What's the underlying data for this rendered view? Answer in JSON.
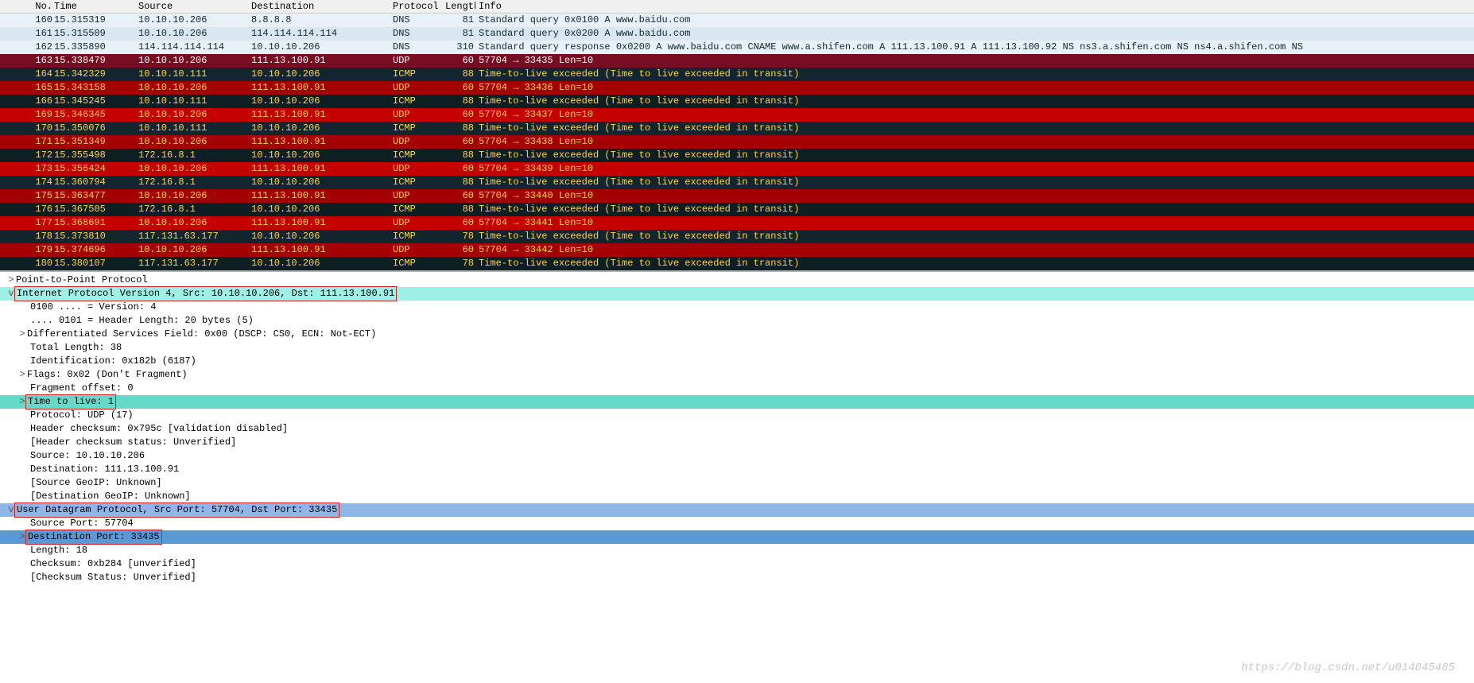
{
  "columns": {
    "no": "No.",
    "time": "Time",
    "src": "Source",
    "dst": "Destination",
    "proto": "Protocol",
    "len": "Length",
    "info": "Info"
  },
  "arrow": "→",
  "packets": [
    {
      "cls": "dns-row",
      "no": 160,
      "time": "15.315319",
      "src": "10.10.10.206",
      "dst": "8.8.8.8",
      "proto": "DNS",
      "len": 81,
      "info": "Standard query 0x0100 A www.baidu.com"
    },
    {
      "cls": "dns-row",
      "no": 161,
      "time": "15.315509",
      "src": "10.10.10.206",
      "dst": "114.114.114.114",
      "proto": "DNS",
      "len": 81,
      "info": "Standard query 0x0200 A www.baidu.com"
    },
    {
      "cls": "dns-row",
      "no": 162,
      "time": "15.335890",
      "src": "114.114.114.114",
      "dst": "10.10.10.206",
      "proto": "DNS",
      "len": 310,
      "info": "Standard query response 0x0200 A www.baidu.com CNAME www.a.shifen.com A 111.13.100.91 A 111.13.100.92 NS ns3.a.shifen.com NS ns4.a.shifen.com NS"
    },
    {
      "cls": "sel-row",
      "no": 163,
      "time": "15.338479",
      "src": "10.10.10.206",
      "dst": "111.13.100.91",
      "proto": "UDP",
      "len": 60,
      "info": "57704 → 33435 Len=10"
    },
    {
      "cls": "blk-row",
      "no": 164,
      "time": "15.342329",
      "src": "10.10.10.111",
      "dst": "10.10.10.206",
      "proto": "ICMP",
      "len": 88,
      "info": "Time-to-live exceeded (Time to live exceeded in transit)"
    },
    {
      "cls": "red-row",
      "no": 165,
      "time": "15.343158",
      "src": "10.10.10.206",
      "dst": "111.13.100.91",
      "proto": "UDP",
      "len": 60,
      "info": "57704 → 33436 Len=10"
    },
    {
      "cls": "blk-row alt",
      "no": 166,
      "time": "15.345245",
      "src": "10.10.10.111",
      "dst": "10.10.10.206",
      "proto": "ICMP",
      "len": 88,
      "info": "Time-to-live exceeded (Time to live exceeded in transit)"
    },
    {
      "cls": "red-row alt",
      "no": 169,
      "time": "15.346345",
      "src": "10.10.10.206",
      "dst": "111.13.100.91",
      "proto": "UDP",
      "len": 60,
      "info": "57704 → 33437 Len=10"
    },
    {
      "cls": "blk-row",
      "no": 170,
      "time": "15.350076",
      "src": "10.10.10.111",
      "dst": "10.10.10.206",
      "proto": "ICMP",
      "len": 88,
      "info": "Time-to-live exceeded (Time to live exceeded in transit)"
    },
    {
      "cls": "red-row",
      "no": 171,
      "time": "15.351349",
      "src": "10.10.10.206",
      "dst": "111.13.100.91",
      "proto": "UDP",
      "len": 60,
      "info": "57704 → 33438 Len=10"
    },
    {
      "cls": "blk-row alt",
      "no": 172,
      "time": "15.355498",
      "src": "172.16.8.1",
      "dst": "10.10.10.206",
      "proto": "ICMP",
      "len": 88,
      "info": "Time-to-live exceeded (Time to live exceeded in transit)"
    },
    {
      "cls": "red-row alt",
      "no": 173,
      "time": "15.356424",
      "src": "10.10.10.206",
      "dst": "111.13.100.91",
      "proto": "UDP",
      "len": 60,
      "info": "57704 → 33439 Len=10"
    },
    {
      "cls": "blk-row",
      "no": 174,
      "time": "15.360794",
      "src": "172.16.8.1",
      "dst": "10.10.10.206",
      "proto": "ICMP",
      "len": 88,
      "info": "Time-to-live exceeded (Time to live exceeded in transit)"
    },
    {
      "cls": "red-row",
      "no": 175,
      "time": "15.363477",
      "src": "10.10.10.206",
      "dst": "111.13.100.91",
      "proto": "UDP",
      "len": 60,
      "info": "57704 → 33440 Len=10"
    },
    {
      "cls": "blk-row alt",
      "no": 176,
      "time": "15.367505",
      "src": "172.16.8.1",
      "dst": "10.10.10.206",
      "proto": "ICMP",
      "len": 88,
      "info": "Time-to-live exceeded (Time to live exceeded in transit)"
    },
    {
      "cls": "red-row alt",
      "no": 177,
      "time": "15.368691",
      "src": "10.10.10.206",
      "dst": "111.13.100.91",
      "proto": "UDP",
      "len": 60,
      "info": "57704 → 33441 Len=10"
    },
    {
      "cls": "blk-row",
      "no": 178,
      "time": "15.373810",
      "src": "117.131.63.177",
      "dst": "10.10.10.206",
      "proto": "ICMP",
      "len": 78,
      "info": "Time-to-live exceeded (Time to live exceeded in transit)"
    },
    {
      "cls": "red-row",
      "no": 179,
      "time": "15.374696",
      "src": "10.10.10.206",
      "dst": "111.13.100.91",
      "proto": "UDP",
      "len": 60,
      "info": "57704 → 33442 Len=10"
    },
    {
      "cls": "blk-row alt",
      "no": 180,
      "time": "15.380107",
      "src": "117.131.63.177",
      "dst": "10.10.10.206",
      "proto": "ICMP",
      "len": 78,
      "info": "Time-to-live exceeded (Time to live exceeded in transit)"
    }
  ],
  "detail": {
    "ppp": {
      "exp": ">",
      "text": "Point-to-Point Protocol"
    },
    "ipv4": {
      "exp": "v",
      "text": "Internet Protocol Version 4, Src: 10.10.10.206, Dst: 111.13.100.91"
    },
    "ver": {
      "text": "0100 .... = Version: 4"
    },
    "ihl": {
      "text": ".... 0101 = Header Length: 20 bytes (5)"
    },
    "dsf": {
      "exp": ">",
      "text": "Differentiated Services Field: 0x00 (DSCP: CS0, ECN: Not-ECT)"
    },
    "tlen": {
      "text": "Total Length: 38"
    },
    "id": {
      "text": "Identification: 0x182b (6187)"
    },
    "flags": {
      "exp": ">",
      "text": "Flags: 0x02 (Don't Fragment)"
    },
    "frag": {
      "text": "Fragment offset: 0"
    },
    "ttl": {
      "exp": ">",
      "text": "Time to live: 1"
    },
    "protoL": {
      "text": "Protocol: UDP (17)"
    },
    "hcsum": {
      "text": "Header checksum: 0x795c [validation disabled]"
    },
    "hcsumS": {
      "text": "[Header checksum status: Unverified]"
    },
    "srcip": {
      "text": "Source: 10.10.10.206"
    },
    "dstip": {
      "text": "Destination: 111.13.100.91"
    },
    "geo1": {
      "text": "[Source GeoIP: Unknown]"
    },
    "geo2": {
      "text": "[Destination GeoIP: Unknown]"
    },
    "udp": {
      "exp": "v",
      "text": "User Datagram Protocol, Src Port: 57704, Dst Port: 33435"
    },
    "sport": {
      "text": "Source Port: 57704"
    },
    "dport": {
      "exp": ">",
      "text": "Destination Port: 33435"
    },
    "ulen": {
      "text": "Length: 18"
    },
    "ucsum": {
      "text": "Checksum: 0xb284 [unverified]"
    },
    "ucsumS": {
      "text": "[Checksum Status: Unverified]"
    }
  },
  "watermark": "https://blog.csdn.net/u014045485"
}
